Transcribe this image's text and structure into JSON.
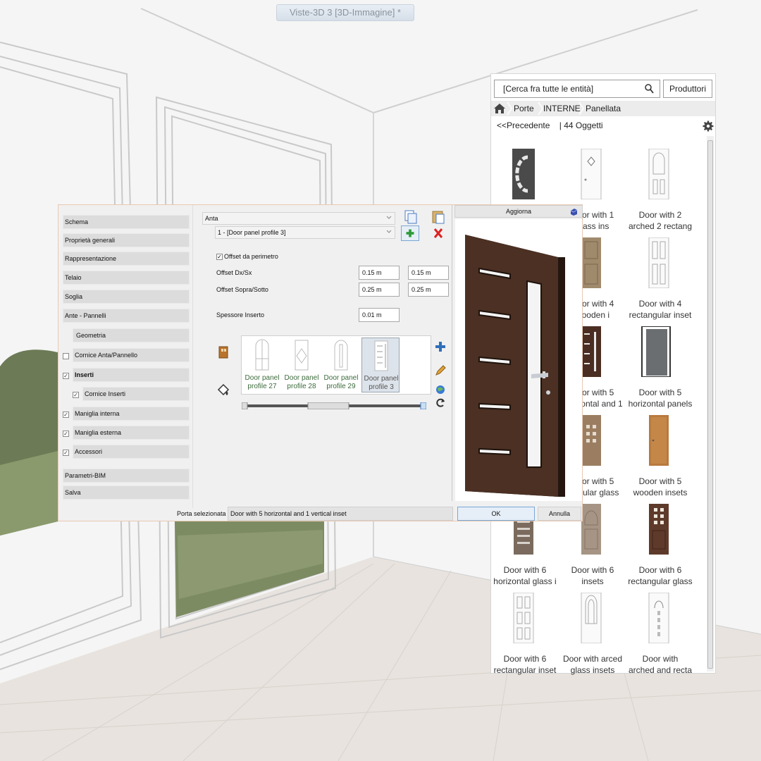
{
  "window": {
    "title": "Viste-3D 3 [3D-Immagine] *"
  },
  "catalog": {
    "search_placeholder": "[Cerca fra tutte le entità]",
    "producers_label": "Produttori",
    "breadcrumb": [
      "Porte",
      "INTERNE",
      "Panellata"
    ],
    "back_label": "<<Precedente",
    "count_label": "| 44 Oggetti",
    "items": [
      {
        "line1": "",
        "line2": ""
      },
      {
        "line1": "Door with 1",
        "line2": "glass ins"
      },
      {
        "line1": "Door with 2",
        "line2": "arched 2 rectang"
      },
      {
        "line1": "Door with 4",
        "line2": "wooden i"
      },
      {
        "line1": "Door with 4",
        "line2": "rectangular inset"
      },
      {
        "line1": "Door with 5",
        "line2": "horizontal and 1"
      },
      {
        "line1": "Door with 5",
        "line2": "horizontal panels"
      },
      {
        "line1": "Door with 5",
        "line2": "modular glass"
      },
      {
        "line1": "Door with 5",
        "line2": "wooden insets"
      },
      {
        "line1": "Door with 6",
        "line2": "horizontal glass i"
      },
      {
        "line1": "Door with 6",
        "line2": "insets"
      },
      {
        "line1": "Door with 6",
        "line2": "rectangular glass"
      },
      {
        "line1": "Door with 6",
        "line2": "rectangular inset"
      },
      {
        "line1": "Door with arced",
        "line2": "glass insets"
      },
      {
        "line1": "Door with",
        "line2": "arched and recta"
      }
    ]
  },
  "dialog": {
    "nav": [
      {
        "label": "Schema"
      },
      {
        "label": "Proprietà generali"
      },
      {
        "label": "Rappresentazione"
      },
      {
        "label": "Telaio"
      },
      {
        "label": "Soglia"
      },
      {
        "label": "Ante - Pannelli"
      },
      {
        "label": "Geometria"
      },
      {
        "label": "Cornice Anta/Pannello"
      },
      {
        "label": "Inserti"
      },
      {
        "label": "Cornice Inserti"
      },
      {
        "label": "Maniglia interna"
      },
      {
        "label": "Maniglia esterna"
      },
      {
        "label": "Accessori"
      },
      {
        "label": "Parametri-BIM"
      },
      {
        "label": "Salva"
      }
    ],
    "combo_anta": "Anta",
    "combo_profile": "1 - [Door panel profile 3]",
    "offset_perimeter_label": "Offset da perimetro",
    "offset_dx_label": "Offset Dx/Sx",
    "offset_dx_1": "0.15 m",
    "offset_dx_2": "0.15 m",
    "offset_top_label": "Offset Sopra/Sotto",
    "offset_top_1": "0.25 m",
    "offset_top_2": "0.25 m",
    "thickness_label": "Spessore Inserto",
    "thickness_value": "0.01 m",
    "profiles": [
      {
        "line1": "Door panel",
        "line2": "profile 27"
      },
      {
        "line1": "Door panel",
        "line2": "profile 28"
      },
      {
        "line1": "Door panel",
        "line2": "profile 29"
      },
      {
        "line1": "Door panel",
        "line2": "profile 3"
      }
    ],
    "update_label": "Aggiorna",
    "selected_door_label": "Porta selezionata",
    "selected_door_value": "Door with 5 horizontal and 1 vertical inset",
    "ok_label": "OK",
    "cancel_label": "Annulla"
  }
}
